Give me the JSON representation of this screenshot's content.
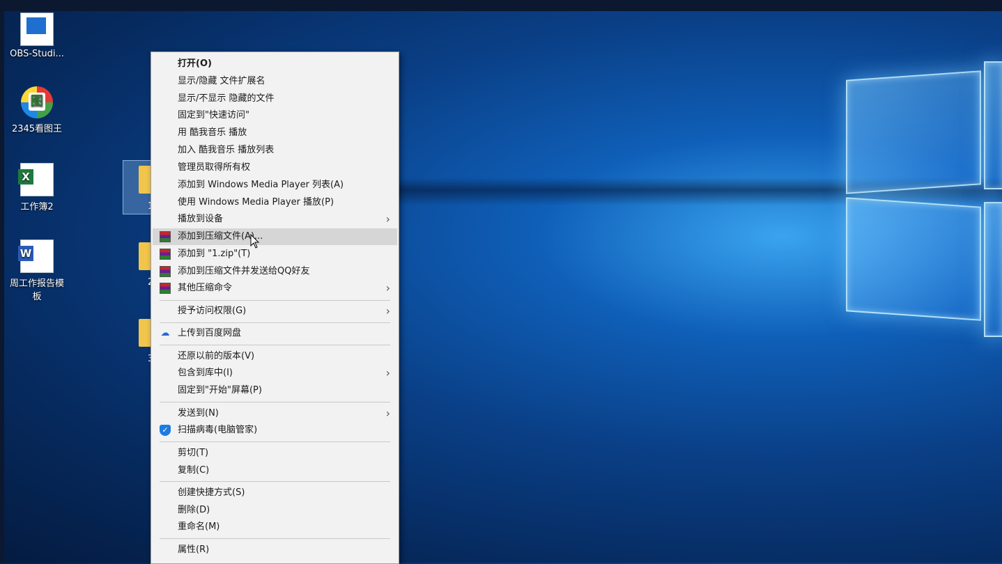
{
  "desktop": {
    "icons": [
      {
        "label": "OBS-Studi..."
      },
      {
        "label": "2345看图王"
      },
      {
        "label": "工作簿2"
      },
      {
        "label": "周工作报告模板"
      }
    ],
    "stray_labels": [
      "1",
      "2",
      "3"
    ]
  },
  "context_menu": {
    "items": [
      {
        "label": "打开(O)"
      },
      {
        "label": "显示/隐藏 文件扩展名"
      },
      {
        "label": "显示/不显示 隐藏的文件"
      },
      {
        "label": "固定到\"快速访问\""
      },
      {
        "label": "用 酷我音乐 播放"
      },
      {
        "label": "加入 酷我音乐 播放列表"
      },
      {
        "label": "管理员取得所有权"
      },
      {
        "label": "添加到 Windows Media Player 列表(A)"
      },
      {
        "label": "使用 Windows Media Player 播放(P)"
      },
      {
        "label": "播放到设备"
      },
      {
        "label": "添加到压缩文件(A)..."
      },
      {
        "label": "添加到 \"1.zip\"(T)"
      },
      {
        "label": "添加到压缩文件并发送给QQ好友"
      },
      {
        "label": "其他压缩命令"
      },
      {
        "label": "授予访问权限(G)"
      },
      {
        "label": "上传到百度网盘"
      },
      {
        "label": "还原以前的版本(V)"
      },
      {
        "label": "包含到库中(I)"
      },
      {
        "label": "固定到\"开始\"屏幕(P)"
      },
      {
        "label": "发送到(N)"
      },
      {
        "label": "扫描病毒(电脑管家)"
      },
      {
        "label": "剪切(T)"
      },
      {
        "label": "复制(C)"
      },
      {
        "label": "创建快捷方式(S)"
      },
      {
        "label": "删除(D)"
      },
      {
        "label": "重命名(M)"
      },
      {
        "label": "属性(R)"
      }
    ],
    "submenu_arrow": "›",
    "hovered_item": "添加到压缩文件(A)..."
  },
  "icon_names": {
    "obs": "obs-studio-icon",
    "viewer": "image-viewer-icon",
    "excel": "excel-file-icon",
    "word": "word-file-icon",
    "archive": "winrar-archive-icon",
    "baidu": "baidu-cloud-icon",
    "guard": "pc-manager-shield-icon"
  },
  "colors": {
    "desktop_blue": "#0a3f86",
    "menu_bg": "#f2f2f2",
    "menu_hover": "#d6d6d6"
  }
}
